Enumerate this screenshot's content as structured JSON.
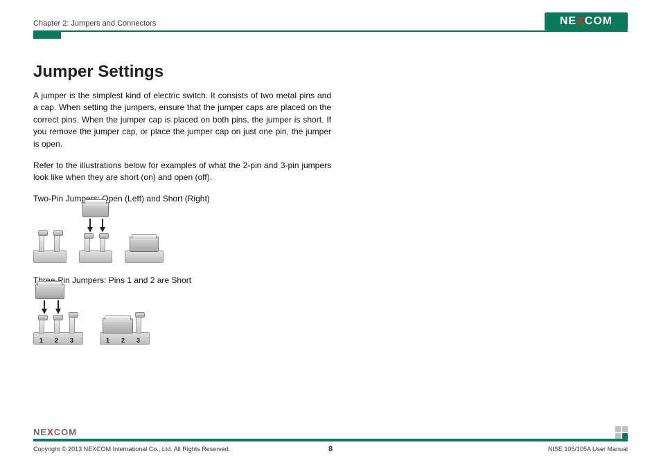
{
  "header": {
    "chapter": "Chapter 2: Jumpers and Connectors",
    "logo_text_pre": "NE",
    "logo_text_x": "X",
    "logo_text_post": "COM"
  },
  "content": {
    "title": "Jumper Settings",
    "paragraph1": "A jumper is the simplest kind of electric switch. It consists of two metal pins and a cap. When setting the jumpers, ensure that the jumper caps are placed on the correct pins. When the jumper cap is placed on both pins, the jumper is short. If you remove the jumper cap, or place the jumper cap on just one pin, the jumper is open.",
    "paragraph2": "Refer to the illustrations below for examples of what the 2-pin and 3-pin jumpers look like when they are short (on) and open (off).",
    "caption1": "Two-Pin Jumpers: Open (Left) and Short (Right)",
    "caption2": "Three-Pin Jumpers: Pins 1 and 2 are Short",
    "pin_labels": {
      "p1": "1",
      "p2": "2",
      "p3": "3"
    }
  },
  "footer": {
    "copyright": "Copyright © 2013 NEXCOM International Co., Ltd. All Rights Reserved.",
    "page": "8",
    "manual": "NISE 105/105A User Manual",
    "logo_text_pre": "NE",
    "logo_text_x": "X",
    "logo_text_post": "COM"
  }
}
